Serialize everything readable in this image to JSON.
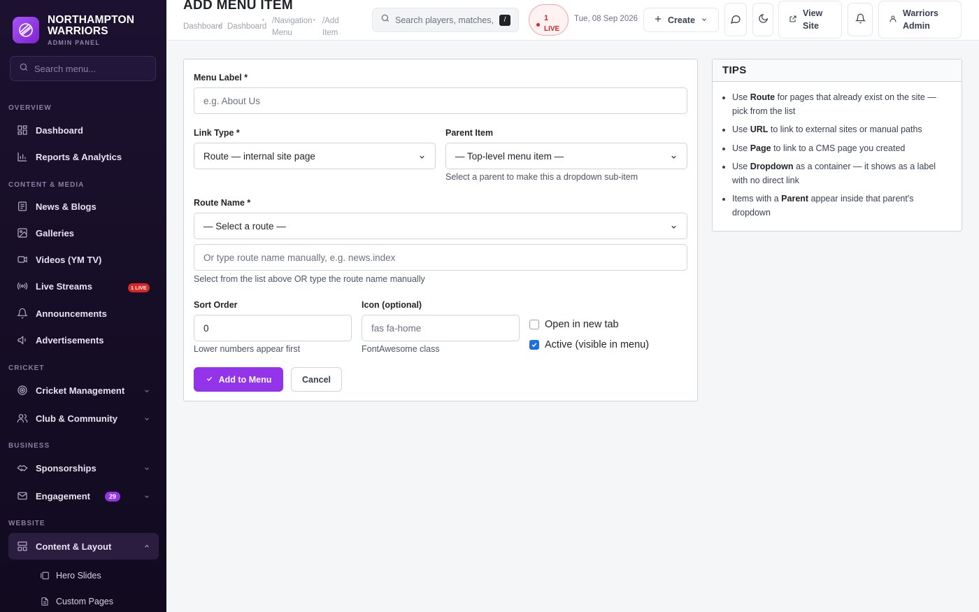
{
  "brand": {
    "name_line1": "NORTHAMPTON",
    "name_line2": "WARRIORS",
    "subtitle": "ADMIN PANEL"
  },
  "sidebar": {
    "search_placeholder": "Search menu...",
    "sections": {
      "overview": "OVERVIEW",
      "content_media": "CONTENT & MEDIA",
      "cricket": "CRICKET",
      "business": "BUSINESS",
      "website": "WEBSITE"
    },
    "items": {
      "dashboard": "Dashboard",
      "reports": "Reports & Analytics",
      "news": "News & Blogs",
      "galleries": "Galleries",
      "videos": "Videos (YM TV)",
      "live_streams": "Live Streams",
      "live_badge": "1 LIVE",
      "announcements": "Announcements",
      "advertisements": "Advertisements",
      "cricket_mgmt": "Cricket Management",
      "club_community": "Club & Community",
      "sponsorships": "Sponsorships",
      "engagement": "Engagement",
      "engagement_badge": "29",
      "content_layout": "Content & Layout",
      "hero_slides": "Hero Slides",
      "custom_pages": "Custom Pages"
    }
  },
  "topbar": {
    "title": "ADD MENU ITEM",
    "breadcrumbs": [
      "Dashboard",
      "Dashboard",
      "/Navigation",
      "Menu",
      "/Add",
      "Item"
    ],
    "search_placeholder": "Search players, matches, n",
    "search_shortcut": "/",
    "live_count": "1",
    "live_label": "LIVE",
    "date": "Tue, 08 Sep 2026",
    "create_label": "Create",
    "view_site_line1": "View",
    "view_site_line2": "Site",
    "user_line1": "Warriors",
    "user_line2": "Admin"
  },
  "form": {
    "menu_label": {
      "label": "Menu Label *",
      "placeholder": "e.g. About Us"
    },
    "link_type": {
      "label": "Link Type *",
      "value": "Route — internal site page"
    },
    "parent_item": {
      "label": "Parent Item",
      "value": "— Top-level menu item —",
      "help": "Select a parent to make this a dropdown sub-item"
    },
    "route_name": {
      "label": "Route Name *",
      "value": "— Select a route —",
      "manual_placeholder": "Or type route name manually, e.g. news.index",
      "help": "Select from the list above OR type the route name manually"
    },
    "sort_order": {
      "label": "Sort Order",
      "value": "0",
      "help": "Lower numbers appear first"
    },
    "icon": {
      "label": "Icon (optional)",
      "placeholder": "fas fa-home",
      "help": "FontAwesome class"
    },
    "open_new_tab": {
      "label": "Open in new tab",
      "checked": false
    },
    "active": {
      "label": "Active (visible in menu)",
      "checked": true
    },
    "submit_label": "Add to Menu",
    "cancel_label": "Cancel"
  },
  "tips": {
    "title": "TIPS",
    "items": [
      {
        "pre": "Use ",
        "bold": "Route",
        "post": " for pages that already exist on the site — pick from the list"
      },
      {
        "pre": "Use ",
        "bold": "URL",
        "post": " to link to external sites or manual paths"
      },
      {
        "pre": "Use ",
        "bold": "Page",
        "post": " to link to a CMS page you created"
      },
      {
        "pre": "Use ",
        "bold": "Dropdown",
        "post": " as a container — it shows as a label with no direct link"
      },
      {
        "pre": "Items with a ",
        "bold": "Parent",
        "post": " appear inside that parent's dropdown"
      }
    ]
  },
  "colors": {
    "accent": "#9333ea",
    "sidebar_bg": "#1c1130",
    "live_red": "#dc2626"
  }
}
